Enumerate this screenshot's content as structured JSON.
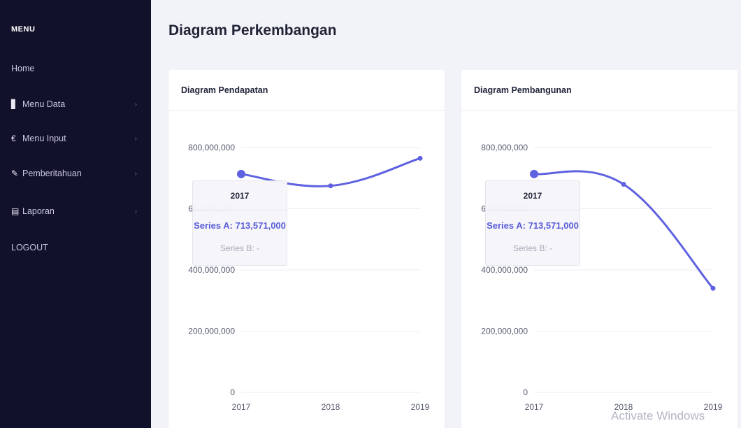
{
  "sidebar": {
    "title": "MENU",
    "items": [
      {
        "label": "Home",
        "icon": "",
        "chevron": ""
      },
      {
        "label": "Menu Data",
        "icon": "file-icon",
        "chevron": "›"
      },
      {
        "label": "Menu Input",
        "icon": "euro-icon",
        "chevron": "›"
      },
      {
        "label": "Pemberitahuan",
        "icon": "edit-icon",
        "chevron": "›"
      },
      {
        "label": "Laporan",
        "icon": "clipboard-icon",
        "chevron": "›"
      },
      {
        "label": "LOGOUT",
        "icon": "",
        "chevron": ""
      }
    ],
    "icon_glyphs": {
      "file": "▋",
      "euro": "€",
      "edit": "✎",
      "clipboard": "▤"
    }
  },
  "page": {
    "title": "Diagram Perkembangan"
  },
  "cards": [
    {
      "title": "Diagram Pendapatan"
    },
    {
      "title": "Diagram Pembangunan"
    }
  ],
  "tooltips": [
    {
      "title": "2017",
      "series_a": "Series A: 713,571,000",
      "series_b": "Series B: -"
    },
    {
      "title": "2017",
      "series_a": "Series A: 713,571,000",
      "series_b": "Series B: -"
    }
  ],
  "watermark": "Activate Windows",
  "chart_data": [
    {
      "type": "line",
      "title": "Diagram Pendapatan",
      "categories": [
        "2017",
        "2018",
        "2019"
      ],
      "series": [
        {
          "name": "Series A",
          "values": [
            713571000,
            675000000,
            765000000
          ]
        }
      ],
      "ylim": [
        0,
        800000000
      ],
      "yticks": [
        "0",
        "200,000,000",
        "400,000,000",
        "600,000,000",
        "800,000,000"
      ],
      "ytick_values": [
        0,
        200000000,
        400000000,
        600000000,
        800000000
      ],
      "grid": true,
      "color": "#5f62e0"
    },
    {
      "type": "line",
      "title": "Diagram Pembangunan",
      "categories": [
        "2017",
        "2018",
        "2019"
      ],
      "series": [
        {
          "name": "Series A",
          "values": [
            713571000,
            680000000,
            340000000
          ]
        }
      ],
      "ylim": [
        0,
        800000000
      ],
      "yticks": [
        "0",
        "200,000,000",
        "400,000,000",
        "600,000,000",
        "800,000,000"
      ],
      "ytick_values": [
        0,
        200000000,
        400000000,
        600000000,
        800000000
      ],
      "grid": true,
      "color": "#5f62e0"
    }
  ]
}
